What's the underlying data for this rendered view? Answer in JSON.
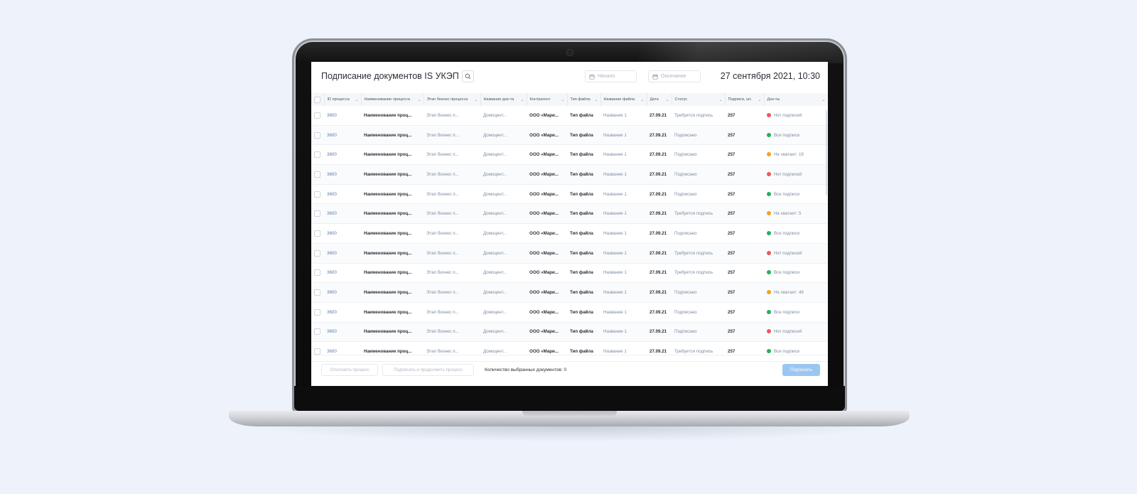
{
  "app": {
    "title": "Подписание документов IS УКЭП",
    "datetime": "27 сентября 2021, 10:30"
  },
  "filters": {
    "start_placeholder": "Начало",
    "end_placeholder": "Окончание",
    "separator": "–"
  },
  "table": {
    "columns": [
      "ID процесса",
      "Наименование процесса",
      "Этап бизнес процесса",
      "Название док-та",
      "Контрагент",
      "Тип файла",
      "Название файла",
      "Дата",
      "Статус",
      "Подписи, шт.",
      "Док-ты"
    ],
    "rows": [
      {
        "id": "3600",
        "name": "Наименование проц...",
        "stage": "Этап бизнес п...",
        "doc": "Домоцент...",
        "party": "ООО «Мари...",
        "ftype": "Тип файла",
        "fname": "Название 1",
        "date": "27.09.21",
        "status": "Требуется подпись",
        "count": "257",
        "docs": "Нет подписей",
        "docs_color": "#f0565a"
      },
      {
        "id": "3600",
        "name": "Наименование проц...",
        "stage": "Этап бизнес п...",
        "doc": "Домоцент...",
        "party": "ООО «Мари...",
        "ftype": "Тип файла",
        "fname": "Название 1",
        "date": "27.09.21",
        "status": "Подписано",
        "count": "257",
        "docs": "Все подписи",
        "docs_color": "#1fb25a"
      },
      {
        "id": "3600",
        "name": "Наименование проц...",
        "stage": "Этап бизнес п...",
        "doc": "Домоцент...",
        "party": "ООО «Мари...",
        "ftype": "Тип файла",
        "fname": "Название 1",
        "date": "27.09.21",
        "status": "Подписано",
        "count": "257",
        "docs": "Не хватает: 19",
        "docs_color": "#f5a31a"
      },
      {
        "id": "3600",
        "name": "Наименование проц...",
        "stage": "Этап бизнес п...",
        "doc": "Домоцент...",
        "party": "ООО «Мари...",
        "ftype": "Тип файла",
        "fname": "Название 1",
        "date": "27.09.21",
        "status": "Подписано",
        "count": "257",
        "docs": "Нет подписей",
        "docs_color": "#f0565a"
      },
      {
        "id": "3600",
        "name": "Наименование проц...",
        "stage": "Этап бизнес п...",
        "doc": "Домоцент...",
        "party": "ООО «Мари...",
        "ftype": "Тип файла",
        "fname": "Название 1",
        "date": "27.09.21",
        "status": "Подписано",
        "count": "257",
        "docs": "Все подписи",
        "docs_color": "#1fb25a"
      },
      {
        "id": "3600",
        "name": "Наименование проц...",
        "stage": "Этап бизнес п...",
        "doc": "Домоцент...",
        "party": "ООО «Мари...",
        "ftype": "Тип файла",
        "fname": "Название 1",
        "date": "27.09.21",
        "status": "Требуется подпись",
        "count": "257",
        "docs": "Не хватает: 5",
        "docs_color": "#f5a31a"
      },
      {
        "id": "3600",
        "name": "Наименование проц...",
        "stage": "Этап бизнес п...",
        "doc": "Домоцент...",
        "party": "ООО «Мари...",
        "ftype": "Тип файла",
        "fname": "Название 1",
        "date": "27.09.21",
        "status": "Подписано",
        "count": "257",
        "docs": "Все подписи",
        "docs_color": "#1fb25a"
      },
      {
        "id": "3600",
        "name": "Наименование проц...",
        "stage": "Этап бизнес п...",
        "doc": "Домоцент...",
        "party": "ООО «Мари...",
        "ftype": "Тип файла",
        "fname": "Название 1",
        "date": "27.09.21",
        "status": "Требуется подпись",
        "count": "257",
        "docs": "Нет подписей",
        "docs_color": "#f0565a"
      },
      {
        "id": "3600",
        "name": "Наименование проц...",
        "stage": "Этап бизнес п...",
        "doc": "Домоцент...",
        "party": "ООО «Мари...",
        "ftype": "Тип файла",
        "fname": "Название 1",
        "date": "27.09.21",
        "status": "Требуется подпись",
        "count": "257",
        "docs": "Все подписи",
        "docs_color": "#1fb25a"
      },
      {
        "id": "3600",
        "name": "Наименование проц...",
        "stage": "Этап бизнес п...",
        "doc": "Домоцент...",
        "party": "ООО «Мари...",
        "ftype": "Тип файла",
        "fname": "Название 1",
        "date": "27.09.21",
        "status": "Подписано",
        "count": "257",
        "docs": "Не хватает: 48",
        "docs_color": "#f5a31a"
      },
      {
        "id": "3600",
        "name": "Наименование проц...",
        "stage": "Этап бизнес п...",
        "doc": "Домоцент...",
        "party": "ООО «Мари...",
        "ftype": "Тип файла",
        "fname": "Название 1",
        "date": "27.09.21",
        "status": "Подписано",
        "count": "257",
        "docs": "Все подписи",
        "docs_color": "#1fb25a"
      },
      {
        "id": "3600",
        "name": "Наименование проц...",
        "stage": "Этап бизнес п...",
        "doc": "Домоцент...",
        "party": "ООО «Мари...",
        "ftype": "Тип файла",
        "fname": "Название 1",
        "date": "27.09.21",
        "status": "Подписано",
        "count": "257",
        "docs": "Нет подписей",
        "docs_color": "#f0565a"
      },
      {
        "id": "3600",
        "name": "Наименование проц...",
        "stage": "Этап бизнес п...",
        "doc": "Домоцент...",
        "party": "ООО «Мари...",
        "ftype": "Тип файла",
        "fname": "Название 1",
        "date": "27.09.21",
        "status": "Требуется подпись",
        "count": "257",
        "docs": "Все подписи",
        "docs_color": "#1fb25a"
      }
    ]
  },
  "footer": {
    "reject_label": "Отклонить процесс",
    "sign_continue_label": "Подписать и продолжить процесс",
    "selected_label": "Количество выбранных документов: 0",
    "sign_label": "Подписать"
  },
  "colors": {
    "accent": "#9cc6f2",
    "link": "#5b7aa8",
    "status_red": "#f0565a",
    "status_green": "#1fb25a",
    "status_orange": "#f5a31a"
  },
  "icons": [
    "search-icon",
    "calendar-icon",
    "chevron-down-icon",
    "checkbox-icon"
  ]
}
